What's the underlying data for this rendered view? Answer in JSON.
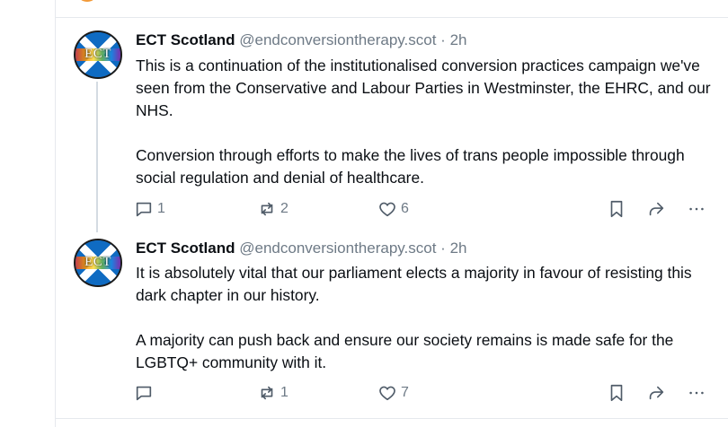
{
  "posts": [
    {
      "author": {
        "display_name": "ECT Scotland",
        "handle": "@endconversiontherapy.scot",
        "separator": "·",
        "time": "2h",
        "avatar_text": "ECT"
      },
      "paragraphs": [
        "This is a continuation of the institutionalised conversion practices campaign we've seen from the Conservative and Labour Parties in Westminster, the EHRC, and our NHS.",
        "Conversion through efforts to make the lives of trans people impossible through social regulation and denial of healthcare."
      ],
      "stats": {
        "replies": "1",
        "reposts": "2",
        "likes": "6"
      }
    },
    {
      "author": {
        "display_name": "ECT Scotland",
        "handle": "@endconversiontherapy.scot",
        "separator": "·",
        "time": "2h",
        "avatar_text": "ECT"
      },
      "paragraphs": [
        "It is absolutely vital that our parliament elects a majority in favour of resisting this dark chapter in our history.",
        "A majority can push back and ensure our society remains is made safe for the LGBTQ+ community with it."
      ],
      "stats": {
        "replies": "",
        "reposts": "1",
        "likes": "7"
      }
    }
  ],
  "icons": {
    "reply": "reply-icon",
    "repost": "repost-icon",
    "like": "heart-icon",
    "bookmark": "bookmark-icon",
    "share": "share-icon",
    "more": "more-icon"
  },
  "colors": {
    "text": "#0b0f14",
    "muted": "#6e7a86",
    "avatar_blue": "#0f6bc2",
    "divider": "#e6e9ed"
  }
}
